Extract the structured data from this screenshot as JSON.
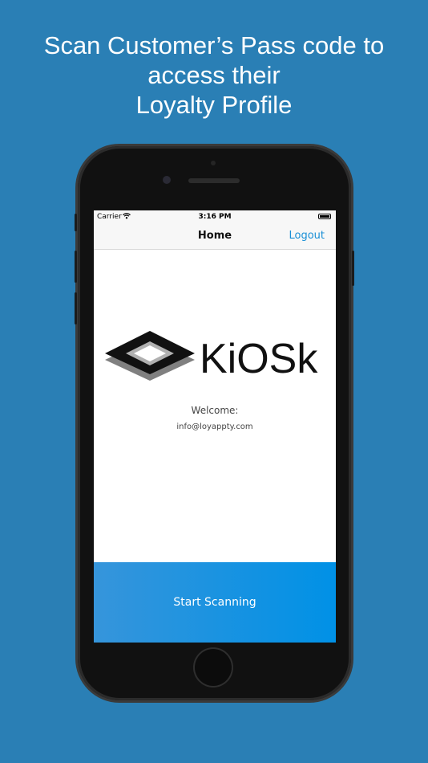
{
  "promo": {
    "line1": "Scan Customer’s Pass code to",
    "line2": "access their",
    "line3": "Loyalty Profile"
  },
  "status_bar": {
    "carrier": "Carrier",
    "time": "3:16 PM"
  },
  "nav": {
    "title": "Home",
    "logout_label": "Logout"
  },
  "logo": {
    "text": "KiOSk"
  },
  "main": {
    "welcome_label": "Welcome:",
    "email": "info@loyappty.com",
    "scan_button_label": "Start Scanning"
  },
  "colors": {
    "background": "#2a7fb5",
    "accent": "#1a8fd6",
    "button": "#0091e6"
  }
}
